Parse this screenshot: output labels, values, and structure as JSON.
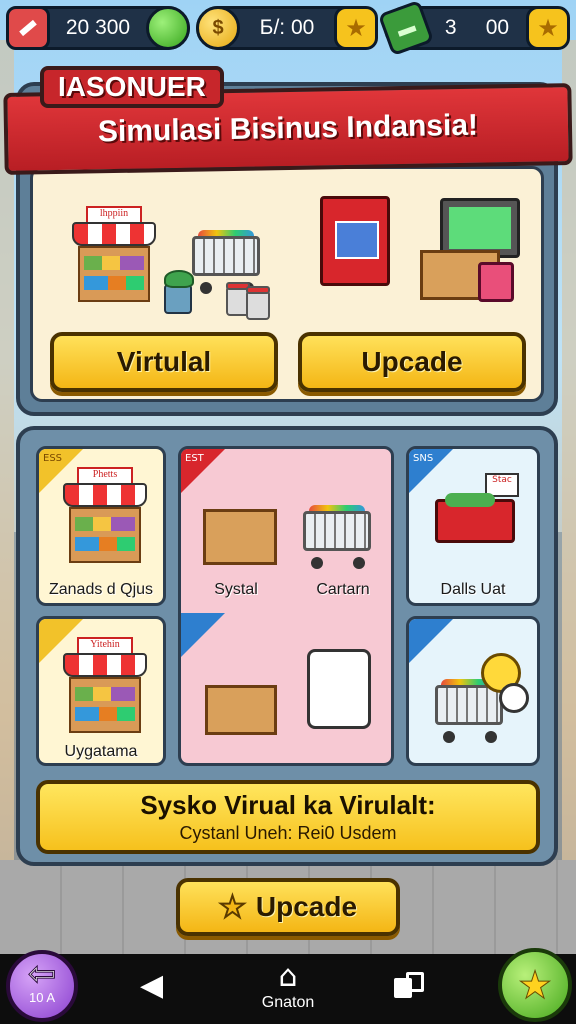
{
  "topbar": {
    "coins_value": "20 300",
    "cash_value": "Б/: 00",
    "gems_value": "3     00",
    "gold_symbol": "$"
  },
  "header": {
    "tag": "IASONUER",
    "title": "Simulasi Bisinus Indansia!",
    "btn_virtual": "Virtulal",
    "btn_upcade": "Upcade"
  },
  "illustrations": {
    "stall_sign": "lhppiin"
  },
  "grid": {
    "cards": [
      {
        "label": "Zanads d Qjus",
        "badge": "ESS",
        "sign": "Phetts"
      },
      {
        "label": "Systal",
        "badge": "EST"
      },
      {
        "label": "Cartarn"
      },
      {
        "label": "Dalls Uat",
        "badge": "SNS",
        "tag": "Stac"
      },
      {
        "label": "Uygatama",
        "sign": "Yitehin"
      }
    ]
  },
  "info": {
    "title": "Sysko Virual ka Virulalt:",
    "subtitle": "Cystanl Uneh: Rei0 Usdem"
  },
  "bottom_button": {
    "label": "Upcade"
  },
  "nav": {
    "home_label": "Gnaton",
    "level": "10 A"
  }
}
